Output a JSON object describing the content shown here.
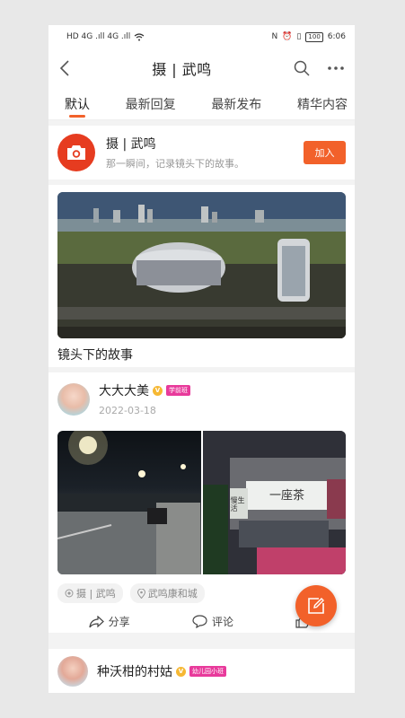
{
  "statusbar": {
    "left": "HD 4G .ıll 4G .ıll",
    "icons": [
      "nfc-icon",
      "alarm-icon",
      "vibrate-icon"
    ],
    "battery": "100",
    "time": "6:06"
  },
  "navbar": {
    "title": "摄 | 武鸣",
    "icons": [
      "back-icon",
      "search-icon",
      "more-icon"
    ]
  },
  "tabs": [
    {
      "label": "默认",
      "active": true
    },
    {
      "label": "最新回复",
      "active": false
    },
    {
      "label": "最新发布",
      "active": false
    },
    {
      "label": "精华内容",
      "active": false
    }
  ],
  "group": {
    "name": "摄 | 武鸣",
    "desc": "那一瞬间，记录镜头下的故事。",
    "join_label": "加入",
    "icon": "camera-icon"
  },
  "banner": {
    "caption": "镜头下的故事"
  },
  "post": {
    "username": "大大大美",
    "vbadge": "V",
    "level_tag": "学前班",
    "date": "2022-03-18",
    "shop_sign": "一座茶",
    "shop_sign_side": "慢生活",
    "tags": [
      {
        "icon": "group-icon",
        "label": "摄 | 武鸣"
      },
      {
        "icon": "location-icon",
        "label": "武鸣康和城"
      }
    ],
    "actions": [
      {
        "icon": "share-icon",
        "label": "分享"
      },
      {
        "icon": "comment-icon",
        "label": "评论"
      },
      {
        "icon": "like-icon",
        "label": ""
      }
    ]
  },
  "post2": {
    "username": "种沃柑的村姑",
    "vbadge": "V",
    "level_tag": "幼儿园小班"
  },
  "fab": {
    "icon": "edit-icon"
  },
  "colors": {
    "accent": "#f2612a",
    "camera_red": "#e63c20",
    "level_tag": "#e83a9b",
    "vbadge": "#f6b833"
  }
}
